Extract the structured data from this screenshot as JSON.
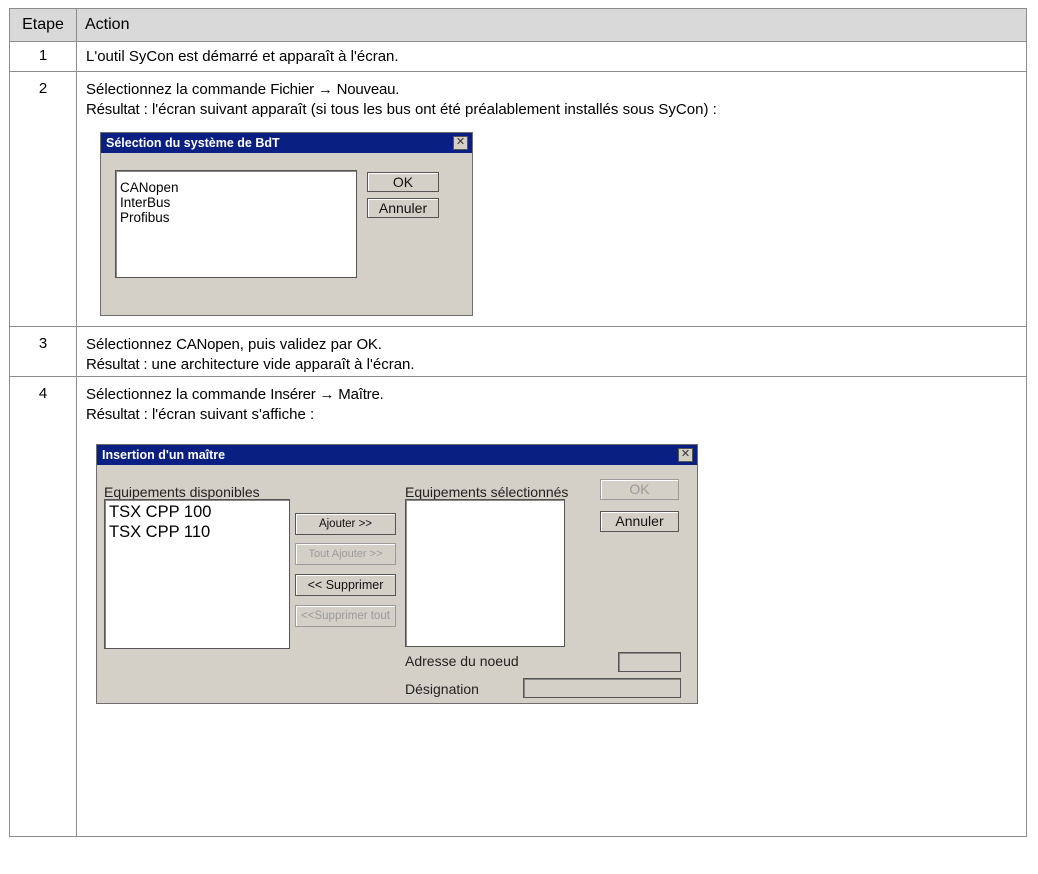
{
  "table": {
    "header": {
      "step": "Etape",
      "action": "Action"
    },
    "rows": [
      {
        "step": "1",
        "text": "L'outil SyCon est démarré et apparaît à l'écran."
      },
      {
        "step": "2",
        "line1_pre": "Sélectionnez la commande ",
        "line1_bold": "Fichier → Nouveau",
        "line1_post": ".",
        "result_label": "Résultat",
        "result_text": " : l'écran suivant apparaît (si tous les bus ont été préalablement installés sous SyCon) :"
      },
      {
        "step": "3",
        "line1_pre": "Sélectionnez ",
        "line1_bold1": "CANopen",
        "line1_mid": ", puis validez par ",
        "line1_bold2": "OK",
        "line1_post": ".",
        "result_label": "Résultat :",
        "result_text": " une architecture vide apparaît à l'écran."
      },
      {
        "step": "4",
        "line1_pre": "Sélectionnez la commande ",
        "line1_bold": "Insérer → Maître",
        "line1_post": ".",
        "result_label": "Résultat",
        "result_text": " : l'écran suivant s'affiche :"
      }
    ]
  },
  "dialog1": {
    "title": "Sélection du système de BdT",
    "close_glyph": "✕",
    "items": [
      "CANopen",
      "InterBus",
      "Profibus"
    ],
    "ok_label": "OK",
    "cancel_label": "Annuler"
  },
  "dialog2": {
    "title": "Insertion d'un maître",
    "close_glyph": "✕",
    "available_label": "Equipements disponibles",
    "available_items": [
      "TSX CPP 100",
      "TSX CPP 110"
    ],
    "selected_label": "Equipements sélectionnés",
    "ok_label": "OK",
    "cancel_label": "Annuler",
    "add_label": "Ajouter >>",
    "add_all_label": "Tout Ajouter >>",
    "remove_label": "<< Supprimer",
    "remove_all_label": "<<Supprimer tout",
    "node_address_label": "Adresse du noeud",
    "designation_label": "Désignation"
  }
}
